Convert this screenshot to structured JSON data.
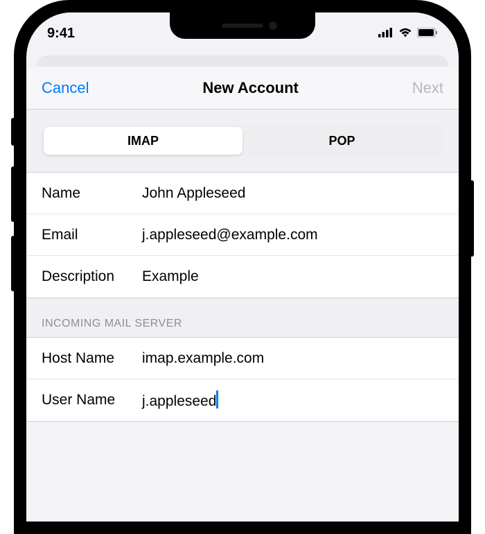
{
  "status": {
    "time": "9:41"
  },
  "nav": {
    "cancel": "Cancel",
    "title": "New Account",
    "next": "Next"
  },
  "segments": {
    "imap": "IMAP",
    "pop": "POP"
  },
  "account": {
    "name_label": "Name",
    "name_value": "John Appleseed",
    "email_label": "Email",
    "email_value": "j.appleseed@example.com",
    "desc_label": "Description",
    "desc_value": "Example"
  },
  "incoming": {
    "header": "INCOMING MAIL SERVER",
    "host_label": "Host Name",
    "host_value": "imap.example.com",
    "user_label": "User Name",
    "user_value": "j.appleseed"
  }
}
